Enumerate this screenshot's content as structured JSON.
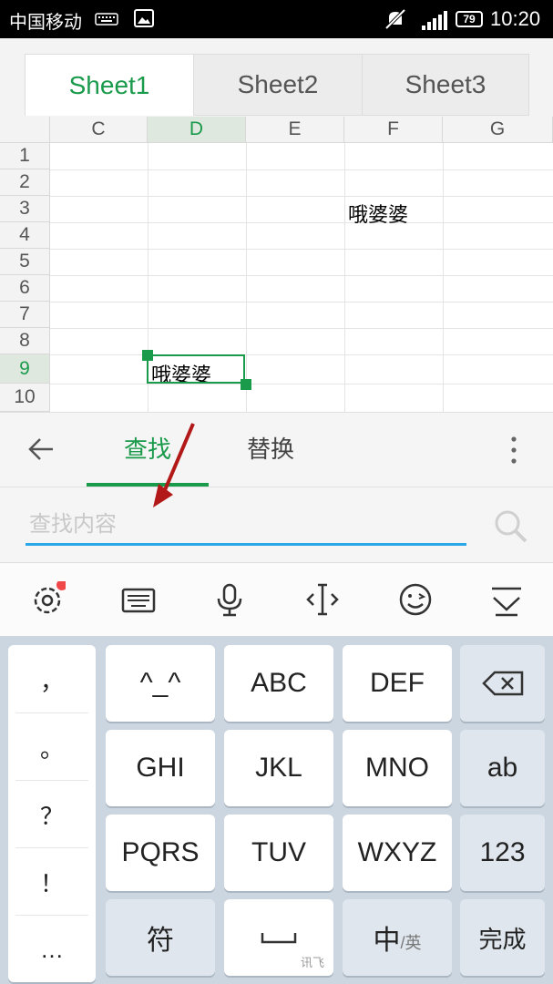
{
  "status_bar": {
    "carrier": "中国移动",
    "battery": "79",
    "time": "10:20"
  },
  "sheet_tabs": [
    "Sheet1",
    "Sheet2",
    "Sheet3"
  ],
  "grid": {
    "columns": [
      "C",
      "D",
      "E",
      "F",
      "G"
    ],
    "rows": [
      "1",
      "2",
      "3",
      "4",
      "5",
      "6",
      "7",
      "8",
      "9",
      "10"
    ],
    "cell_f3": "哦婆婆",
    "cell_d9": "哦婆婆"
  },
  "find_panel": {
    "tab_find": "查找",
    "tab_replace": "替换",
    "search_placeholder": "查找内容"
  },
  "keyboard": {
    "punctuation": [
      "，",
      "。",
      "？",
      "！",
      "…"
    ],
    "keys": {
      "emoticon": "^_^",
      "abc": "ABC",
      "def": "DEF",
      "ghi": "GHI",
      "jkl": "JKL",
      "mno": "MNO",
      "pqrs": "PQRS",
      "tuv": "TUV",
      "wxyz": "WXYZ",
      "ab": "ab",
      "num": "123",
      "symbol": "符",
      "space_sub": "讯飞",
      "lang_main": "中",
      "lang_sub": "/英",
      "done": "完成"
    }
  },
  "colors": {
    "accent_green": "#1a9a4b",
    "input_underline": "#2aa7e8",
    "keyboard_bg": "#cbd6e0"
  }
}
